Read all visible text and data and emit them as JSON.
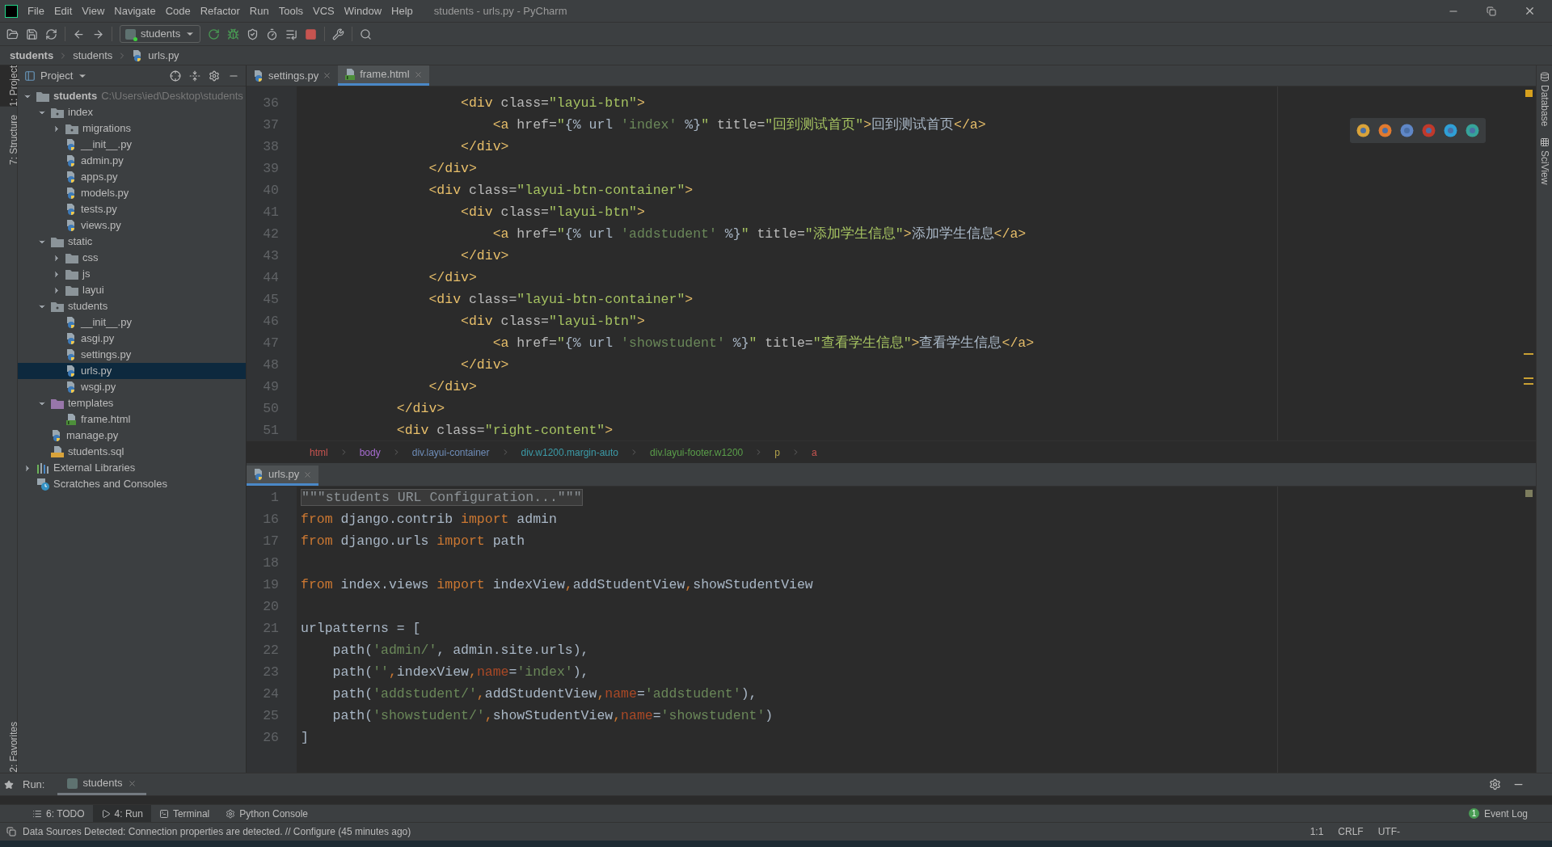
{
  "window": {
    "title": "students - urls.py - PyCharm"
  },
  "menu": [
    "File",
    "Edit",
    "View",
    "Navigate",
    "Code",
    "Refactor",
    "Run",
    "Tools",
    "VCS",
    "Window",
    "Help"
  ],
  "toolbar": {
    "run_config": "students"
  },
  "nav_bar": [
    {
      "label": "students",
      "kind": "project"
    },
    {
      "label": "students",
      "kind": "folder"
    },
    {
      "label": "urls.py",
      "kind": "py"
    }
  ],
  "left_strip": {
    "top": [
      {
        "label": "1: Project",
        "selected": true
      },
      {
        "label": "7: Structure",
        "selected": false
      }
    ],
    "bottom": [
      {
        "label": "2: Favorites",
        "selected": false
      }
    ]
  },
  "right_strip": [
    "Database",
    "SciView"
  ],
  "project_panel": {
    "title": "Project",
    "tree": [
      {
        "label": "students",
        "note": "C:\\Users\\ied\\Desktop\\students",
        "kind": "folder",
        "expanded": true,
        "selected": false,
        "children": [
          {
            "label": "index",
            "kind": "source-folder",
            "expanded": true,
            "selected": false,
            "children": [
              {
                "label": "migrations",
                "kind": "source-folder",
                "expanded": false,
                "selected": false
              },
              {
                "label": "__init__.py",
                "kind": "py",
                "selected": false
              },
              {
                "label": "admin.py",
                "kind": "py",
                "selected": false
              },
              {
                "label": "apps.py",
                "kind": "py",
                "selected": false
              },
              {
                "label": "models.py",
                "kind": "py",
                "selected": false
              },
              {
                "label": "tests.py",
                "kind": "py",
                "selected": false
              },
              {
                "label": "views.py",
                "kind": "py",
                "selected": false
              }
            ]
          },
          {
            "label": "static",
            "kind": "folder",
            "expanded": true,
            "selected": false,
            "children": [
              {
                "label": "css",
                "kind": "folder",
                "expanded": false,
                "selected": false
              },
              {
                "label": "js",
                "kind": "folder",
                "expanded": false,
                "selected": false
              },
              {
                "label": "layui",
                "kind": "folder",
                "expanded": false,
                "selected": false
              }
            ]
          },
          {
            "label": "students",
            "kind": "source-folder",
            "expanded": true,
            "selected": false,
            "children": [
              {
                "label": "__init__.py",
                "kind": "py",
                "selected": false
              },
              {
                "label": "asgi.py",
                "kind": "py",
                "selected": false
              },
              {
                "label": "settings.py",
                "kind": "py",
                "selected": false
              },
              {
                "label": "urls.py",
                "kind": "py",
                "selected": true
              },
              {
                "label": "wsgi.py",
                "kind": "py",
                "selected": false
              }
            ]
          },
          {
            "label": "templates",
            "kind": "templates",
            "expanded": true,
            "selected": false,
            "children": [
              {
                "label": "frame.html",
                "kind": "html",
                "selected": false
              }
            ]
          },
          {
            "label": "manage.py",
            "kind": "py",
            "selected": false
          },
          {
            "label": "students.sql",
            "kind": "sql",
            "selected": false
          }
        ]
      },
      {
        "label": "External Libraries",
        "kind": "libraries",
        "expanded": false,
        "selected": false
      },
      {
        "label": "Scratches and Consoles",
        "kind": "scratches",
        "selected": false
      }
    ]
  },
  "top_editor": {
    "tabs": [
      {
        "label": "settings.py",
        "kind": "py",
        "selected": false
      },
      {
        "label": "frame.html",
        "kind": "html",
        "selected": true
      }
    ],
    "lines": [
      {
        "number": "36",
        "tokens": [
          {
            "text": "                    <div",
            "kind": "tag"
          },
          {
            "text": " class=",
            "kind": "attr"
          },
          {
            "text": "\"layui-btn\"",
            "kind": "str"
          },
          {
            "text": ">",
            "kind": "tag"
          }
        ]
      },
      {
        "number": "37",
        "tokens": [
          {
            "text": "                        <a",
            "kind": "tag"
          },
          {
            "text": " href=",
            "kind": "attr"
          },
          {
            "text": "\"",
            "kind": "str"
          },
          {
            "text": "{% url ",
            "kind": "plain"
          },
          {
            "text": "'index'",
            "kind": "tplstr"
          },
          {
            "text": " %}",
            "kind": "plain"
          },
          {
            "text": "\"",
            "kind": "str"
          },
          {
            "text": " title=",
            "kind": "attr"
          },
          {
            "text": "\"回到测试首页\"",
            "kind": "str"
          },
          {
            "text": ">",
            "kind": "tag"
          },
          {
            "text": "回到测试首页",
            "kind": "plain"
          },
          {
            "text": "</a>",
            "kind": "tag"
          }
        ]
      },
      {
        "number": "38",
        "tokens": [
          {
            "text": "                    </div>",
            "kind": "tag"
          }
        ]
      },
      {
        "number": "39",
        "tokens": [
          {
            "text": "                </div>",
            "kind": "tag"
          }
        ]
      },
      {
        "number": "40",
        "tokens": [
          {
            "text": "                <div",
            "kind": "tag"
          },
          {
            "text": " class=",
            "kind": "attr"
          },
          {
            "text": "\"layui-btn-container\"",
            "kind": "str"
          },
          {
            "text": ">",
            "kind": "tag"
          }
        ]
      },
      {
        "number": "41",
        "tokens": [
          {
            "text": "                    <div",
            "kind": "tag"
          },
          {
            "text": " class=",
            "kind": "attr"
          },
          {
            "text": "\"layui-btn\"",
            "kind": "str"
          },
          {
            "text": ">",
            "kind": "tag"
          }
        ]
      },
      {
        "number": "42",
        "tokens": [
          {
            "text": "                        <a",
            "kind": "tag"
          },
          {
            "text": " href=",
            "kind": "attr"
          },
          {
            "text": "\"",
            "kind": "str"
          },
          {
            "text": "{% url ",
            "kind": "plain"
          },
          {
            "text": "'addstudent'",
            "kind": "tplstr"
          },
          {
            "text": " %}",
            "kind": "plain"
          },
          {
            "text": "\"",
            "kind": "str"
          },
          {
            "text": " title=",
            "kind": "attr"
          },
          {
            "text": "\"添加学生信息\"",
            "kind": "str"
          },
          {
            "text": ">",
            "kind": "tag"
          },
          {
            "text": "添加学生信息",
            "kind": "plain"
          },
          {
            "text": "</a>",
            "kind": "tag"
          }
        ]
      },
      {
        "number": "43",
        "tokens": [
          {
            "text": "                    </div>",
            "kind": "tag"
          }
        ]
      },
      {
        "number": "44",
        "tokens": [
          {
            "text": "                </div>",
            "kind": "tag"
          }
        ]
      },
      {
        "number": "45",
        "tokens": [
          {
            "text": "                <div",
            "kind": "tag"
          },
          {
            "text": " class=",
            "kind": "attr"
          },
          {
            "text": "\"layui-btn-container\"",
            "kind": "str"
          },
          {
            "text": ">",
            "kind": "tag"
          }
        ]
      },
      {
        "number": "46",
        "tokens": [
          {
            "text": "                    <div",
            "kind": "tag"
          },
          {
            "text": " class=",
            "kind": "attr"
          },
          {
            "text": "\"layui-btn\"",
            "kind": "str"
          },
          {
            "text": ">",
            "kind": "tag"
          }
        ]
      },
      {
        "number": "47",
        "tokens": [
          {
            "text": "                        <a",
            "kind": "tag"
          },
          {
            "text": " href=",
            "kind": "attr"
          },
          {
            "text": "\"",
            "kind": "str"
          },
          {
            "text": "{% url ",
            "kind": "plain"
          },
          {
            "text": "'showstudent'",
            "kind": "tplstr"
          },
          {
            "text": " %}",
            "kind": "plain"
          },
          {
            "text": "\"",
            "kind": "str"
          },
          {
            "text": " title=",
            "kind": "attr"
          },
          {
            "text": "\"查看学生信息\"",
            "kind": "str"
          },
          {
            "text": ">",
            "kind": "tag"
          },
          {
            "text": "查看学生信息",
            "kind": "plain"
          },
          {
            "text": "</a>",
            "kind": "tag"
          }
        ]
      },
      {
        "number": "48",
        "tokens": [
          {
            "text": "                    </div>",
            "kind": "tag"
          }
        ]
      },
      {
        "number": "49",
        "tokens": [
          {
            "text": "                </div>",
            "kind": "tag"
          }
        ]
      },
      {
        "number": "50",
        "tokens": [
          {
            "text": "            </div>",
            "kind": "tag"
          }
        ]
      },
      {
        "number": "51",
        "tokens": [
          {
            "text": "            <div",
            "kind": "tag"
          },
          {
            "text": " class=",
            "kind": "attr"
          },
          {
            "text": "\"right-content\"",
            "kind": "str"
          },
          {
            "text": ">",
            "kind": "tag"
          }
        ]
      }
    ],
    "breadcrumb": [
      {
        "label": "html",
        "color": "#c75450"
      },
      {
        "label": "body",
        "color": "#a66ccf"
      },
      {
        "label": "div.layui-container",
        "color": "#6e8cb7"
      },
      {
        "label": "div.w1200.margin-auto",
        "color": "#3c9ba8"
      },
      {
        "label": "div.layui-footer.w1200",
        "color": "#5a9e4a"
      },
      {
        "label": "p",
        "color": "#b0a04a"
      },
      {
        "label": "a",
        "color": "#c75450"
      }
    ]
  },
  "bottom_editor": {
    "tabs": [
      {
        "label": "urls.py",
        "kind": "py",
        "selected": true
      }
    ],
    "lines": [
      {
        "number": "1",
        "tokens": [
          {
            "text": "\"\"\"students URL Configuration...\"\"\"",
            "kind": "doc"
          }
        ]
      },
      {
        "number": "16",
        "tokens": [
          {
            "text": "from",
            "kind": "kw"
          },
          {
            "text": " django.contrib ",
            "kind": "plain"
          },
          {
            "text": "import",
            "kind": "kw"
          },
          {
            "text": " admin",
            "kind": "plain"
          }
        ]
      },
      {
        "number": "17",
        "tokens": [
          {
            "text": "from",
            "kind": "kw"
          },
          {
            "text": " django.urls ",
            "kind": "plain"
          },
          {
            "text": "import",
            "kind": "kw"
          },
          {
            "text": " path",
            "kind": "plain"
          }
        ]
      },
      {
        "number": "18"
      },
      {
        "number": "19",
        "tokens": [
          {
            "text": "from",
            "kind": "kw"
          },
          {
            "text": " index.views ",
            "kind": "plain"
          },
          {
            "text": "import",
            "kind": "kw"
          },
          {
            "text": " indexView",
            "kind": "plain"
          },
          {
            "text": ",",
            "kind": "kw"
          },
          {
            "text": "addStudentView",
            "kind": "plain"
          },
          {
            "text": ",",
            "kind": "kw"
          },
          {
            "text": "showStudentView",
            "kind": "plain"
          }
        ]
      },
      {
        "number": "20"
      },
      {
        "number": "21",
        "tokens": [
          {
            "text": "urlpatterns = [",
            "kind": "plain"
          }
        ]
      },
      {
        "number": "22",
        "tokens": [
          {
            "text": "    path(",
            "kind": "plain"
          },
          {
            "text": "'admin/'",
            "kind": "pystr"
          },
          {
            "text": ", admin.site.urls),",
            "kind": "plain"
          }
        ]
      },
      {
        "number": "23",
        "tokens": [
          {
            "text": "    path(",
            "kind": "plain"
          },
          {
            "text": "''",
            "kind": "pystr"
          },
          {
            "text": ",",
            "kind": "kw"
          },
          {
            "text": "indexView",
            "kind": "plain"
          },
          {
            "text": ",",
            "kind": "kw"
          },
          {
            "text": "name",
            "kind": "param"
          },
          {
            "text": "=",
            "kind": "plain"
          },
          {
            "text": "'index'",
            "kind": "pystr"
          },
          {
            "text": "),",
            "kind": "plain"
          }
        ]
      },
      {
        "number": "24",
        "tokens": [
          {
            "text": "    path(",
            "kind": "plain"
          },
          {
            "text": "'addstudent/'",
            "kind": "pystr"
          },
          {
            "text": ",",
            "kind": "kw"
          },
          {
            "text": "addStudentView",
            "kind": "plain"
          },
          {
            "text": ",",
            "kind": "kw"
          },
          {
            "text": "name",
            "kind": "param"
          },
          {
            "text": "=",
            "kind": "plain"
          },
          {
            "text": "'addstudent'",
            "kind": "pystr"
          },
          {
            "text": "),",
            "kind": "plain"
          }
        ]
      },
      {
        "number": "25",
        "tokens": [
          {
            "text": "    path(",
            "kind": "plain"
          },
          {
            "text": "'showstudent/'",
            "kind": "pystr"
          },
          {
            "text": ",",
            "kind": "kw"
          },
          {
            "text": "showStudentView",
            "kind": "plain"
          },
          {
            "text": ",",
            "kind": "kw"
          },
          {
            "text": "name",
            "kind": "param"
          },
          {
            "text": "=",
            "kind": "plain"
          },
          {
            "text": "'showstudent'",
            "kind": "pystr"
          },
          {
            "text": ")",
            "kind": "plain"
          }
        ]
      },
      {
        "number": "26",
        "tokens": [
          {
            "text": "]",
            "kind": "plain"
          }
        ]
      }
    ]
  },
  "run_panel": {
    "label": "Run:",
    "tabs": [
      {
        "label": "students",
        "selected": true
      }
    ]
  },
  "tool_tabs": [
    {
      "label": "6: TODO",
      "kind": "todo",
      "selected": false
    },
    {
      "label": "4: Run",
      "kind": "run",
      "selected": true
    },
    {
      "label": "Terminal",
      "kind": "terminal",
      "selected": false
    },
    {
      "label": "Python Console",
      "kind": "python",
      "selected": false
    }
  ],
  "event_log": {
    "count": "1",
    "label": "Event Log"
  },
  "status_bar": {
    "message": "Data Sources Detected: Connection properties are detected. // Configure (45 minutes ago)",
    "items": [
      "1:1",
      "CRLF",
      "UTF-"
    ]
  }
}
